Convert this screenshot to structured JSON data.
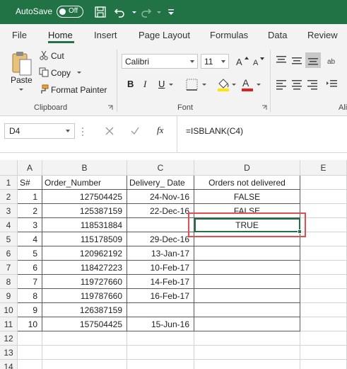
{
  "titlebar": {
    "autosave_label": "AutoSave",
    "toggle_state": "Off"
  },
  "tabs": [
    "File",
    "Home",
    "Insert",
    "Page Layout",
    "Formulas",
    "Data",
    "Review"
  ],
  "ribbon": {
    "clipboard": {
      "paste": "Paste",
      "cut": "Cut",
      "copy": "Copy",
      "format_painter": "Format Painter",
      "label": "Clipboard"
    },
    "font": {
      "name": "Calibri",
      "size": "11",
      "bold": "B",
      "italic": "I",
      "underline": "U",
      "label": "Font"
    },
    "alignment_label": "Ali"
  },
  "formula_bar": {
    "name_box": "D4",
    "fx": "fx",
    "formula": "=ISBLANK(C4)"
  },
  "grid": {
    "columns": [
      "A",
      "B",
      "C",
      "D",
      "E"
    ],
    "rows": [
      {
        "n": "1",
        "a": "S#",
        "b": "Order_Number",
        "c": "Delivery_ Date",
        "d": "Orders not delivered"
      },
      {
        "n": "2",
        "a": "1",
        "b": "127504425",
        "c": "24-Nov-16",
        "d": "FALSE"
      },
      {
        "n": "3",
        "a": "2",
        "b": "125387159",
        "c": "22-Dec-16",
        "d": "FALSE"
      },
      {
        "n": "4",
        "a": "3",
        "b": "118531884",
        "c": "",
        "d": "TRUE"
      },
      {
        "n": "5",
        "a": "4",
        "b": "115178509",
        "c": "29-Dec-16",
        "d": ""
      },
      {
        "n": "6",
        "a": "5",
        "b": "120962192",
        "c": "13-Jan-17",
        "d": ""
      },
      {
        "n": "7",
        "a": "6",
        "b": "118427223",
        "c": "10-Feb-17",
        "d": ""
      },
      {
        "n": "8",
        "a": "7",
        "b": "119727660",
        "c": "14-Feb-17",
        "d": ""
      },
      {
        "n": "9",
        "a": "8",
        "b": "119787660",
        "c": "16-Feb-17",
        "d": ""
      },
      {
        "n": "10",
        "a": "9",
        "b": "126387159",
        "c": "",
        "d": ""
      },
      {
        "n": "11",
        "a": "10",
        "b": "157504425",
        "c": "15-Jun-16",
        "d": ""
      },
      {
        "n": "12",
        "a": "",
        "b": "",
        "c": "",
        "d": ""
      },
      {
        "n": "13",
        "a": "",
        "b": "",
        "c": "",
        "d": ""
      },
      {
        "n": "14",
        "a": "",
        "b": "",
        "c": "",
        "d": ""
      }
    ]
  },
  "colors": {
    "excel_green": "#217346",
    "highlight_red": "#e04e50"
  }
}
